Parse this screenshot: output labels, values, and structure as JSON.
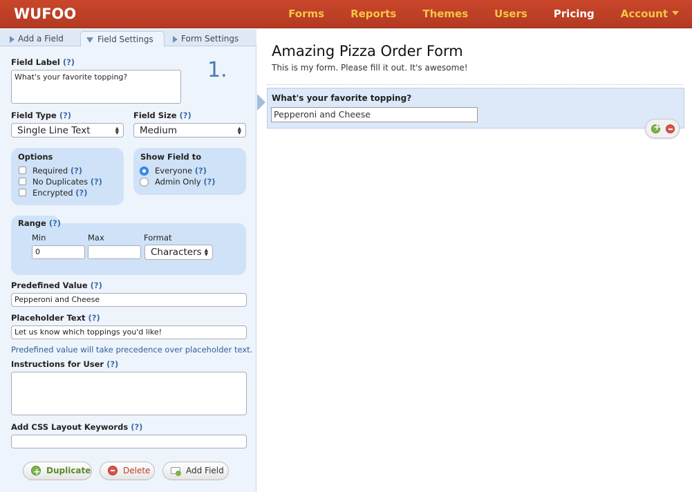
{
  "brand": {
    "logo_text": "WUFOO"
  },
  "nav": {
    "forms": "Forms",
    "reports": "Reports",
    "themes": "Themes",
    "users": "Users",
    "pricing": "Pricing",
    "account": "Account"
  },
  "tabs": {
    "add_field": "Add a Field",
    "field_settings": "Field Settings",
    "form_settings": "Form Settings"
  },
  "field_settings": {
    "step_number": "1.",
    "help": "(?)",
    "field_label": {
      "label": "Field Label",
      "value": "What's your favorite topping?"
    },
    "field_type": {
      "label": "Field Type",
      "value": "Single Line Text"
    },
    "field_size": {
      "label": "Field Size",
      "value": "Medium"
    },
    "options": {
      "title": "Options",
      "required": "Required",
      "no_duplicates": "No Duplicates",
      "encrypted": "Encrypted"
    },
    "show_field": {
      "title": "Show Field to",
      "everyone": "Everyone",
      "admin_only": "Admin Only"
    },
    "range": {
      "title": "Range",
      "min_label": "Min",
      "max_label": "Max",
      "format_label": "Format",
      "min_value": "0",
      "max_value": "",
      "format_value": "Characters"
    },
    "predefined": {
      "label": "Predefined Value",
      "value": "Pepperoni and Cheese"
    },
    "placeholder": {
      "label": "Placeholder Text",
      "value": "Let us know which toppings you'd like!"
    },
    "precedence_note": "Predefined value will take precedence over placeholder text.",
    "instructions": {
      "label": "Instructions for User",
      "value": ""
    },
    "css_keywords": {
      "label": "Add CSS Layout Keywords",
      "value": ""
    },
    "buttons": {
      "duplicate": "Duplicate",
      "delete": "Delete",
      "add_field": "Add Field"
    }
  },
  "form_preview": {
    "title": "Amazing Pizza Order Form",
    "description": "This is my form. Please fill it out. It's awesome!",
    "field_label": "What's your favorite topping?",
    "field_value": "Pepperoni and Cheese"
  },
  "colors": {
    "header": "#c0412a",
    "nav_accent": "#f6c545",
    "panel": "#eef4fb",
    "bubble": "#cfe2f7",
    "link": "#2f5e9a"
  }
}
